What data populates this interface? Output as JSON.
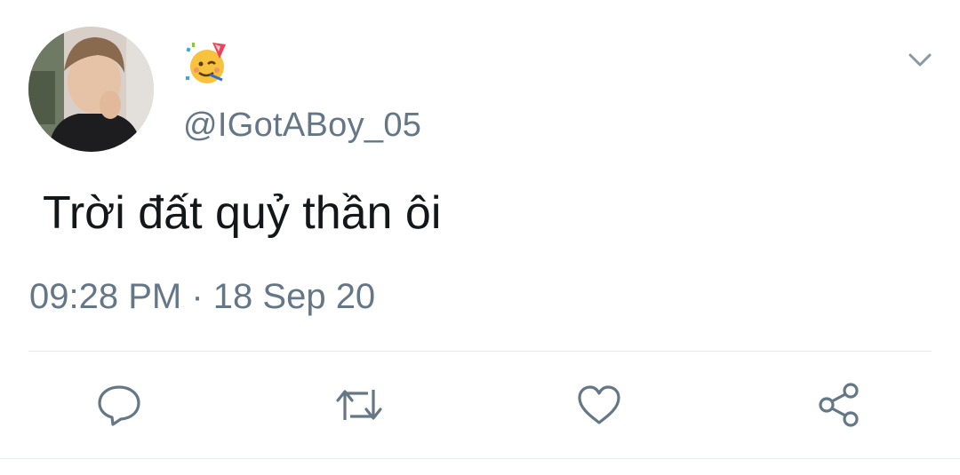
{
  "tweet": {
    "display_name_emoji": "🥳",
    "handle": "@IGotABoy_05",
    "text": "Trời đất quỷ thần ôi",
    "time": "09:28 PM",
    "separator": "·",
    "date": "18 Sep 20"
  },
  "icons": {
    "avatar": "avatar",
    "display_name": "partying-face-icon",
    "menu": "chevron-down-icon",
    "reply": "reply-icon",
    "retweet": "retweet-icon",
    "like": "heart-icon",
    "share": "share-icon"
  },
  "colors": {
    "secondary_text": "#657786",
    "primary_text": "#14171a",
    "divider": "#e1e8ed"
  }
}
